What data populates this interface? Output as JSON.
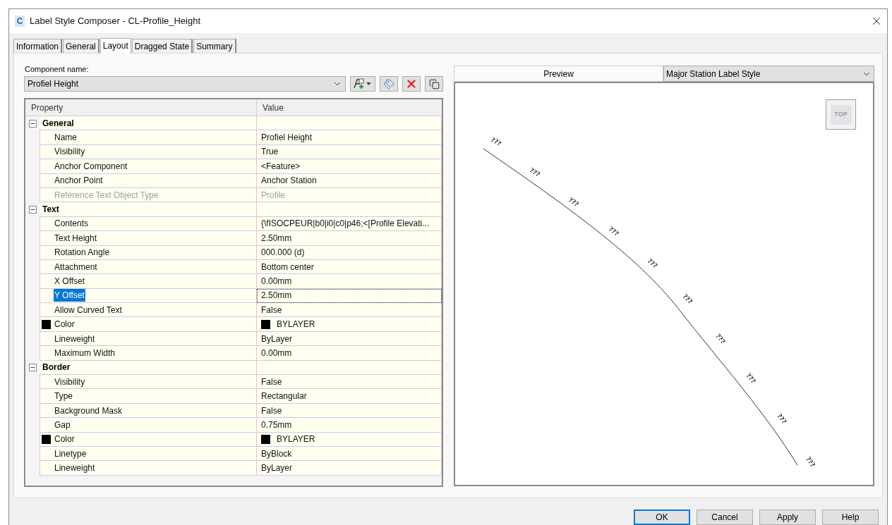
{
  "window": {
    "icon_letter": "C",
    "title": "Label Style Composer - CL-Profile_Height"
  },
  "tabs": [
    {
      "label": "Information",
      "selected": false
    },
    {
      "label": "General",
      "selected": false
    },
    {
      "label": "Layout",
      "selected": true
    },
    {
      "label": "Dragged State",
      "selected": false
    },
    {
      "label": "Summary",
      "selected": false
    }
  ],
  "component": {
    "label": "Component name:",
    "value": "Profiel Height"
  },
  "grid": {
    "columns": [
      "Property",
      "Value"
    ],
    "groups": [
      {
        "name": "General",
        "expanded": true,
        "rows": [
          {
            "property": "Name",
            "value": "Profiel Height",
            "disabled": false,
            "selected": false
          },
          {
            "property": "Visibility",
            "value": "True",
            "disabled": false,
            "selected": false
          },
          {
            "property": "Anchor Component",
            "value": "<Feature>",
            "disabled": false,
            "selected": false
          },
          {
            "property": "Anchor Point",
            "value": "Anchor Station",
            "disabled": false,
            "selected": false
          },
          {
            "property": "Reference Text Object Type",
            "value": "Profile",
            "disabled": true,
            "selected": false
          }
        ]
      },
      {
        "name": "Text",
        "expanded": true,
        "rows": [
          {
            "property": "Contents",
            "value": "{\\fISOCPEUR|b0|i0|c0|p46;<[Profile Elevati...",
            "disabled": false,
            "selected": false
          },
          {
            "property": "Text Height",
            "value": "2.50mm",
            "disabled": false,
            "selected": false
          },
          {
            "property": "Rotation Angle",
            "value": "000.000 (d)",
            "disabled": false,
            "selected": false
          },
          {
            "property": "Attachment",
            "value": "Bottom center",
            "disabled": false,
            "selected": false
          },
          {
            "property": "X Offset",
            "value": "0.00mm",
            "disabled": false,
            "selected": false
          },
          {
            "property": "Y Offset",
            "value": "2.50mm",
            "disabled": false,
            "selected": true
          },
          {
            "property": "Allow Curved Text",
            "value": "False",
            "disabled": false,
            "selected": false
          },
          {
            "property": "Color",
            "value": "BYLAYER",
            "disabled": false,
            "selected": false,
            "color": "#000000"
          },
          {
            "property": "Lineweight",
            "value": "ByLayer",
            "disabled": false,
            "selected": false
          },
          {
            "property": "Maximum Width",
            "value": "0.00mm",
            "disabled": false,
            "selected": false
          }
        ]
      },
      {
        "name": "Border",
        "expanded": true,
        "rows": [
          {
            "property": "Visibility",
            "value": "False",
            "disabled": false,
            "selected": false
          },
          {
            "property": "Type",
            "value": "Rectangular",
            "disabled": false,
            "selected": false
          },
          {
            "property": "Background Mask",
            "value": "False",
            "disabled": false,
            "selected": false
          },
          {
            "property": "Gap",
            "value": "0.75mm",
            "disabled": false,
            "selected": false
          },
          {
            "property": "Color",
            "value": "BYLAYER",
            "disabled": false,
            "selected": false,
            "color": "#000000"
          },
          {
            "property": "Linetype",
            "value": "ByBlock",
            "disabled": false,
            "selected": false
          },
          {
            "property": "Lineweight",
            "value": "ByLayer",
            "disabled": false,
            "selected": false
          }
        ]
      }
    ]
  },
  "preview": {
    "label": "Preview",
    "style": "Major Station Label Style",
    "view_cube": "TOP",
    "station_labels": [
      "???",
      "???",
      "???",
      "???",
      "???",
      "???",
      "???",
      "???",
      "???",
      "???"
    ]
  },
  "buttons": [
    {
      "label": "OK",
      "default": true
    },
    {
      "label": "Cancel",
      "default": false
    },
    {
      "label": "Apply",
      "default": false
    },
    {
      "label": "Help",
      "default": false
    }
  ]
}
